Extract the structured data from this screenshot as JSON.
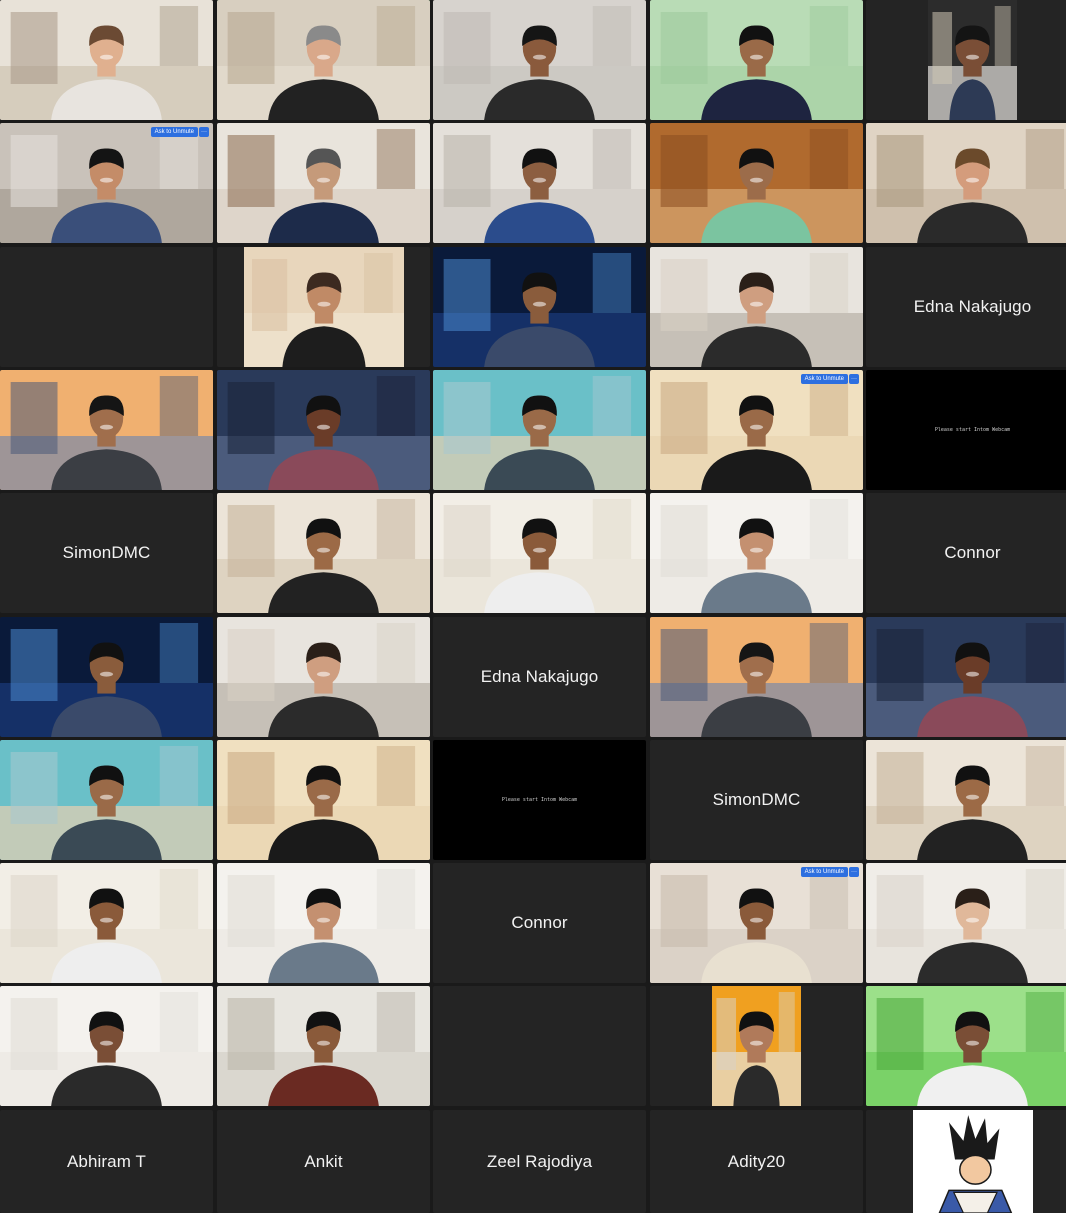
{
  "meeting": {
    "participants_rows": [
      [
        {
          "type": "video",
          "scene": "office-shelves",
          "skin": "#e0b08f",
          "hair": "#6b4a33",
          "shirt": "#e8e4df"
        },
        {
          "type": "video",
          "scene": "studio-shelves",
          "skin": "#d9a88a",
          "hair": "#8a8a8a",
          "shirt": "#222222",
          "active": true
        },
        {
          "type": "video",
          "scene": "plain-wall",
          "skin": "#8a5a3c",
          "hair": "#151515",
          "shirt": "#2a2a2a"
        },
        {
          "type": "video",
          "scene": "green-wall",
          "skin": "#9a6a48",
          "hair": "#111111",
          "shirt": "#1e2440"
        },
        {
          "type": "video",
          "scene": "dark-door",
          "skin": "#7a4e36",
          "hair": "#141414",
          "shirt": "#2d3a55",
          "inset": true
        }
      ],
      [
        {
          "type": "video",
          "scene": "floral-wallpaper",
          "skin": "#c48c68",
          "hair": "#141414",
          "shirt": "#3a4f7a",
          "unmute": true
        },
        {
          "type": "video",
          "scene": "bright-room",
          "skin": "#c59a7a",
          "hair": "#555555",
          "shirt": "#1d2b4a"
        },
        {
          "type": "video",
          "scene": "blurred-room",
          "skin": "#8c5e40",
          "hair": "#111111",
          "shirt": "#2b4c8c"
        },
        {
          "type": "video",
          "scene": "wood-window",
          "skin": "#9c6c4a",
          "hair": "#111111",
          "shirt": "#7bc4a0"
        },
        {
          "type": "video",
          "scene": "home-blur",
          "skin": "#d49c7c",
          "hair": "#6b4a2b",
          "shirt": "#2a2a2a"
        }
      ],
      [
        {
          "type": "empty"
        },
        {
          "type": "video",
          "scene": "beige-wall",
          "skin": "#c08a66",
          "hair": "#3c2a20",
          "shirt": "#1d1d1d",
          "inset": true
        },
        {
          "type": "video",
          "scene": "earth-space",
          "skin": "#8a5c3c",
          "hair": "#111111",
          "shirt": "#3a4a6a"
        },
        {
          "type": "video",
          "scene": "curtain-mural",
          "skin": "#cf9e80",
          "hair": "#2a1f18",
          "shirt": "#2b2b2b"
        },
        {
          "type": "name",
          "label": "Edna Nakajugo"
        }
      ],
      [
        {
          "type": "video",
          "scene": "golden-gate",
          "skin": "#a06e4c",
          "hair": "#151515",
          "shirt": "#3b3e44"
        },
        {
          "type": "video",
          "scene": "city-night",
          "skin": "#6a3c28",
          "hair": "#111111",
          "shirt": "#8a4a5a"
        },
        {
          "type": "video",
          "scene": "teal-blur",
          "skin": "#9a6a48",
          "hair": "#111111",
          "shirt": "#3a4a55"
        },
        {
          "type": "video",
          "scene": "bedroom-chair",
          "skin": "#9a6a48",
          "hair": "#111111",
          "shirt": "#1a1a1a",
          "unmute": true
        },
        {
          "type": "webcam",
          "label": "Please start Intom Webcam"
        }
      ],
      [
        {
          "type": "name",
          "label": "SimonDMC"
        },
        {
          "type": "video",
          "scene": "cream-room",
          "skin": "#9c6a46",
          "hair": "#111111",
          "shirt": "#222222"
        },
        {
          "type": "video",
          "scene": "cream-plain",
          "skin": "#8a5a3a",
          "hair": "#111111",
          "shirt": "#eeeeee"
        },
        {
          "type": "video",
          "scene": "white-plain",
          "skin": "#c49070",
          "hair": "#111111",
          "shirt": "#6a7a8a"
        },
        {
          "type": "name",
          "label": "Connor"
        }
      ],
      [
        {
          "type": "video",
          "scene": "earth-space",
          "skin": "#8a5c3c",
          "hair": "#111111",
          "shirt": "#3a4a6a"
        },
        {
          "type": "video",
          "scene": "curtain-mural",
          "skin": "#cf9e80",
          "hair": "#2a1f18",
          "shirt": "#2b2b2b"
        },
        {
          "type": "name",
          "label": "Edna Nakajugo"
        },
        {
          "type": "video",
          "scene": "golden-gate",
          "skin": "#a06e4c",
          "hair": "#151515",
          "shirt": "#3b3e44"
        },
        {
          "type": "video",
          "scene": "city-night",
          "skin": "#6a3c28",
          "hair": "#111111",
          "shirt": "#8a4a5a"
        }
      ],
      [
        {
          "type": "video",
          "scene": "teal-blur",
          "skin": "#9a6a48",
          "hair": "#111111",
          "shirt": "#3a4a55"
        },
        {
          "type": "video",
          "scene": "bedroom-chair",
          "skin": "#9a6a48",
          "hair": "#111111",
          "shirt": "#1a1a1a"
        },
        {
          "type": "webcam",
          "label": "Please start Intom Webcam"
        },
        {
          "type": "name",
          "label": "SimonDMC"
        },
        {
          "type": "video",
          "scene": "cream-room",
          "skin": "#9c6a46",
          "hair": "#111111",
          "shirt": "#222222"
        }
      ],
      [
        {
          "type": "video",
          "scene": "cream-plain",
          "skin": "#8a5a3a",
          "hair": "#111111",
          "shirt": "#eeeeee"
        },
        {
          "type": "video",
          "scene": "white-plain",
          "skin": "#c49070",
          "hair": "#111111",
          "shirt": "#6a7a8a"
        },
        {
          "type": "name",
          "label": "Connor"
        },
        {
          "type": "video",
          "scene": "soft-room",
          "skin": "#8a5a3a",
          "hair": "#111111",
          "shirt": "#e8e0d0",
          "unmute": true
        },
        {
          "type": "video",
          "scene": "white-door",
          "skin": "#e0b89a",
          "hair": "#2a1f18",
          "shirt": "#2b2b2b"
        }
      ],
      [
        {
          "type": "video",
          "scene": "white-plain",
          "skin": "#7a4e36",
          "hair": "#111111",
          "shirt": "#2a2a2a"
        },
        {
          "type": "video",
          "scene": "lamp-room",
          "skin": "#8a5a3a",
          "hair": "#111111",
          "shirt": "#6a2a22"
        },
        {
          "type": "empty"
        },
        {
          "type": "video",
          "scene": "orange-door",
          "skin": "#b07a5a",
          "hair": "#111111",
          "shirt": "#2a2a2a",
          "inset": true
        },
        {
          "type": "video",
          "scene": "green-glow",
          "skin": "#7a4e36",
          "hair": "#111111",
          "shirt": "#f0f0f0"
        }
      ],
      [
        {
          "type": "name",
          "label": "Abhiram T"
        },
        {
          "type": "name",
          "label": "Ankit"
        },
        {
          "type": "name",
          "label": "Zeel Rajodiya"
        },
        {
          "type": "name",
          "label": "Adity20"
        },
        {
          "type": "avatar",
          "label": "vegeta-avatar"
        }
      ]
    ],
    "unmute_label": "Ask to Unmute",
    "more_label": "···",
    "colors": {
      "background": "#1a1a1a",
      "tile": "#242424",
      "active_border": "#3aa655",
      "unmute_button": "#2d6fe0"
    }
  }
}
